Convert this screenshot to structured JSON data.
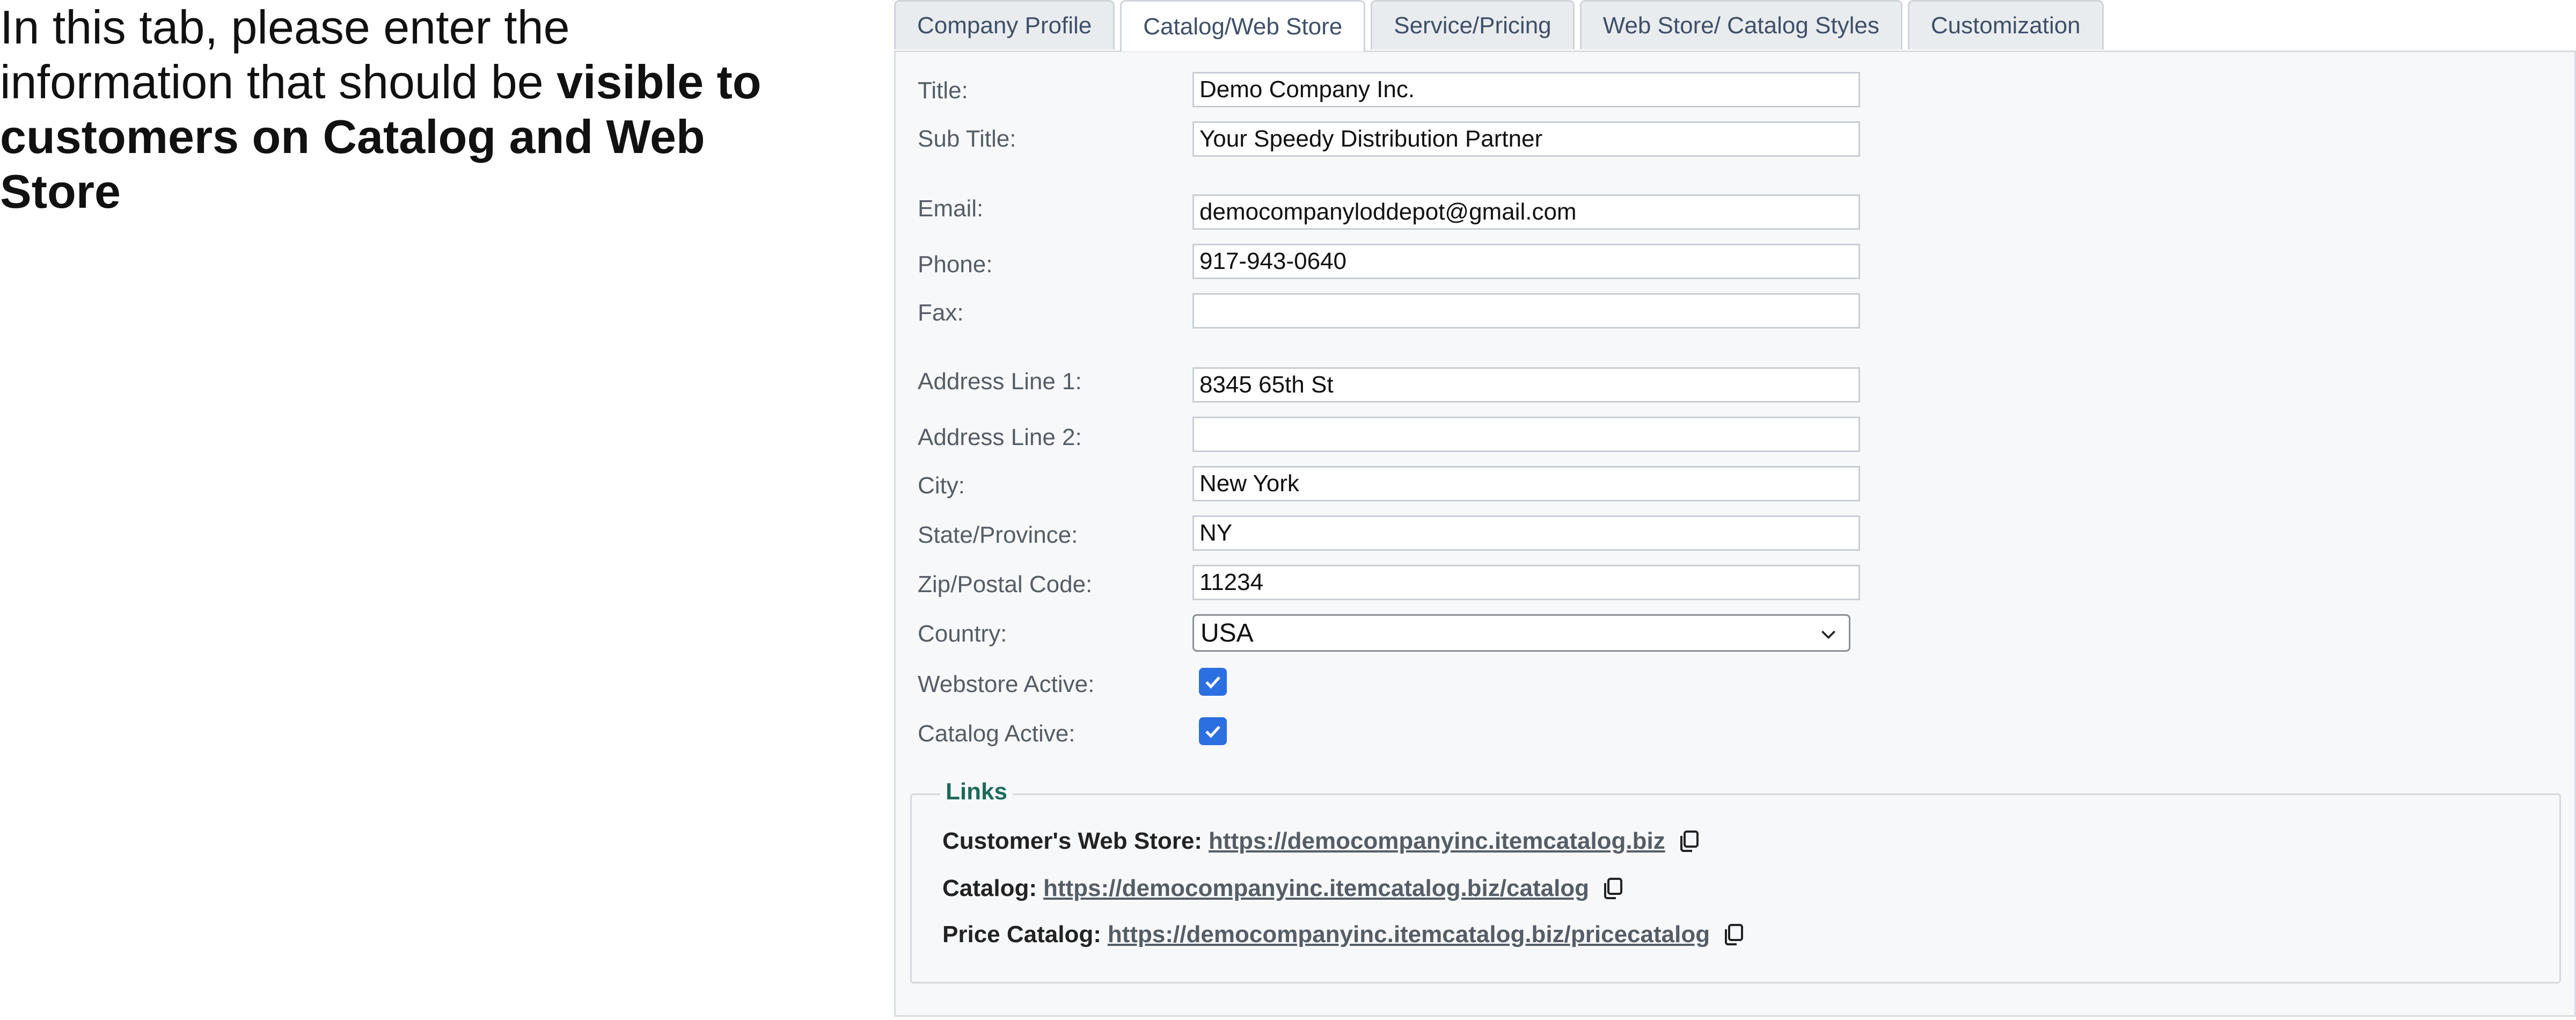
{
  "intro": {
    "text_plain": "In this tab, please enter the information that should be ",
    "text_bold": "visible to customers on Catalog and Web Store"
  },
  "tabs": [
    {
      "label": "Company Profile",
      "active": false
    },
    {
      "label": "Catalog/Web Store",
      "active": true
    },
    {
      "label": "Service/Pricing",
      "active": false
    },
    {
      "label": "Web Store/ Catalog Styles",
      "active": false
    },
    {
      "label": "Customization",
      "active": false
    }
  ],
  "form": {
    "title": {
      "label": "Title:",
      "value": "Demo Company Inc."
    },
    "subtitle": {
      "label": "Sub Title:",
      "value": "Your Speedy Distribution Partner"
    },
    "email": {
      "label": "Email:",
      "value": "democompanyloddepot@gmail.com"
    },
    "phone": {
      "label": "Phone:",
      "value": "917-943-0640"
    },
    "fax": {
      "label": "Fax:",
      "value": ""
    },
    "address1": {
      "label": "Address Line 1:",
      "value": "8345 65th St"
    },
    "address2": {
      "label": "Address Line 2:",
      "value": ""
    },
    "city": {
      "label": "City:",
      "value": "New York"
    },
    "state": {
      "label": "State/Province:",
      "value": "NY"
    },
    "zip": {
      "label": "Zip/Postal Code:",
      "value": "11234"
    },
    "country": {
      "label": "Country:",
      "value": "USA"
    },
    "webstore_active": {
      "label": "Webstore Active:",
      "checked": true
    },
    "catalog_active": {
      "label": "Catalog Active:",
      "checked": true
    }
  },
  "links": {
    "legend": "Links",
    "items": [
      {
        "label": "Customer's Web Store:",
        "url": "https://democompanyinc.itemcatalog.biz"
      },
      {
        "label": "Catalog:",
        "url": "https://democompanyinc.itemcatalog.biz/catalog"
      },
      {
        "label": "Price Catalog:",
        "url": "https://democompanyinc.itemcatalog.biz/pricecatalog"
      }
    ]
  },
  "colors": {
    "accent_checkbox": "#2b6fe0",
    "legend": "#1e6a5a",
    "tab_text": "#3f5068"
  },
  "icons": {
    "copy": "copy-icon",
    "dropdown": "chevron-down-icon",
    "check": "check-icon"
  }
}
